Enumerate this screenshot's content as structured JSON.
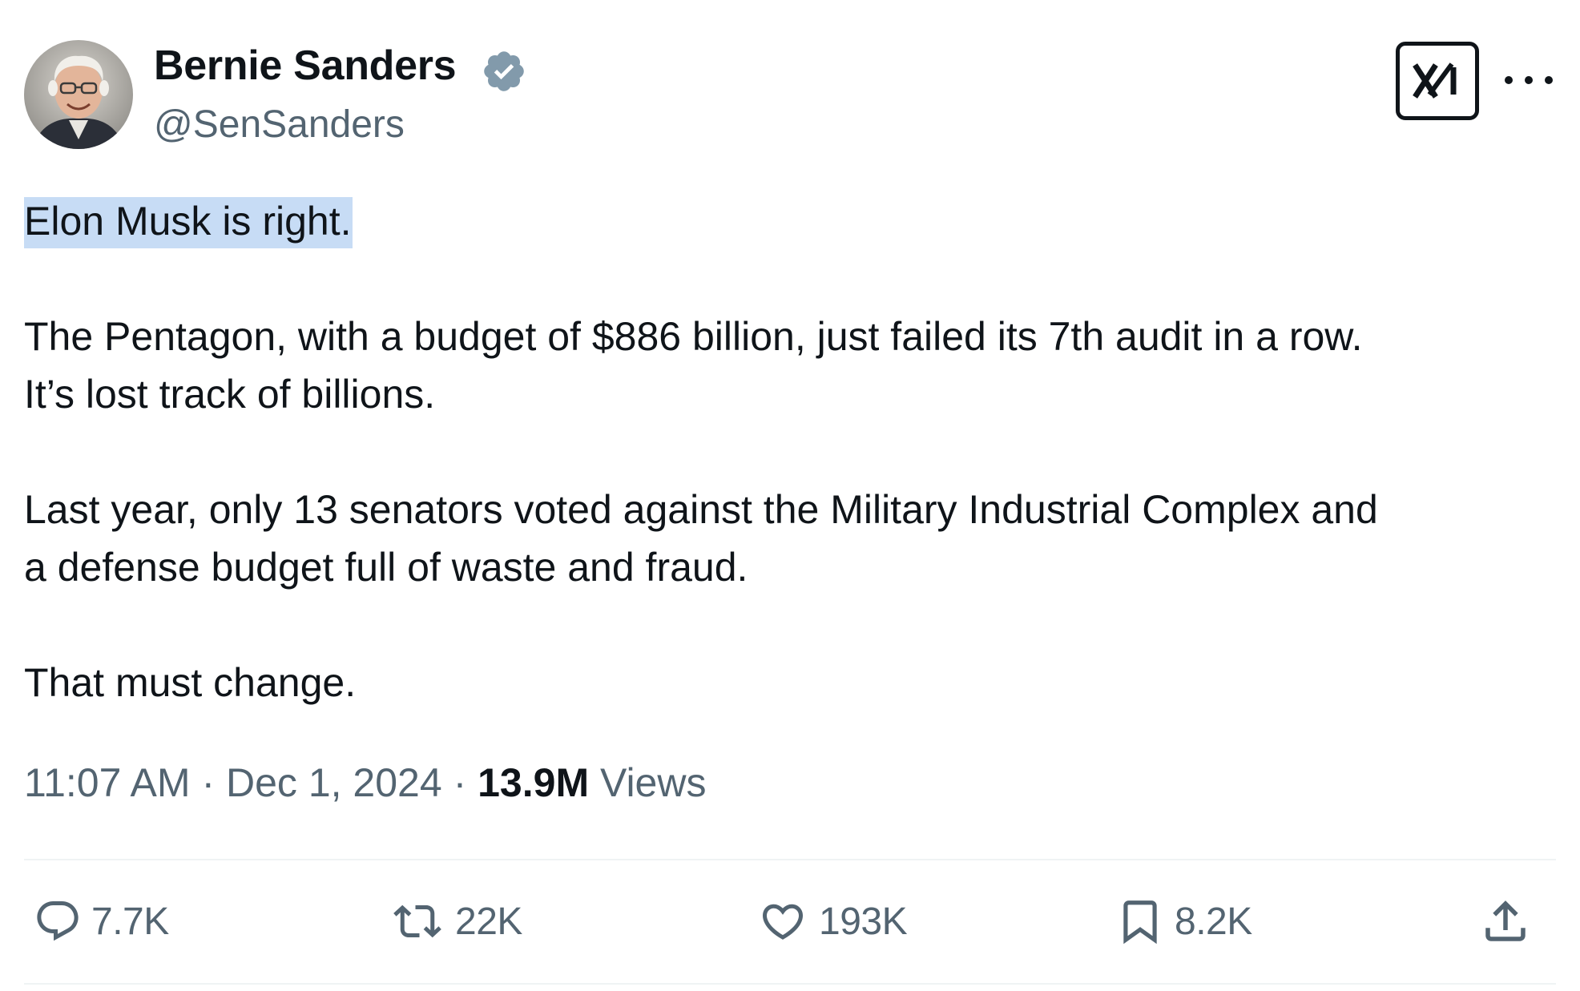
{
  "author": {
    "display_name": "Bernie Sanders",
    "handle": "@SenSanders",
    "verified_color": "#829aab"
  },
  "header_icons": {
    "grok": "grok-icon",
    "more": "more-icon"
  },
  "tweet": {
    "paragraphs": [
      "Elon Musk is right.",
      "The Pentagon, with a budget of $886 billion, just failed its 7th audit in a row.",
      "It’s lost track of billions.",
      "Last year, only 13 senators voted against the Military Industrial Complex and",
      "a defense budget full of waste and fraud.",
      "That must change."
    ],
    "highlight_color": "#c7dcf5"
  },
  "meta": {
    "time": "11:07 AM",
    "separator": "·",
    "date": "Dec 1, 2024",
    "views_count": "13.9M",
    "views_label": "Views"
  },
  "actions": {
    "replies": {
      "icon": "reply-icon",
      "count": "7.7K"
    },
    "reposts": {
      "icon": "repost-icon",
      "count": "22K"
    },
    "likes": {
      "icon": "heart-icon",
      "count": "193K"
    },
    "bookmarks": {
      "icon": "bookmark-icon",
      "count": "8.2K"
    },
    "share": {
      "icon": "share-icon"
    }
  },
  "colors": {
    "text_primary": "#0f1419",
    "text_secondary": "#536471",
    "divider": "#eff3f4"
  }
}
